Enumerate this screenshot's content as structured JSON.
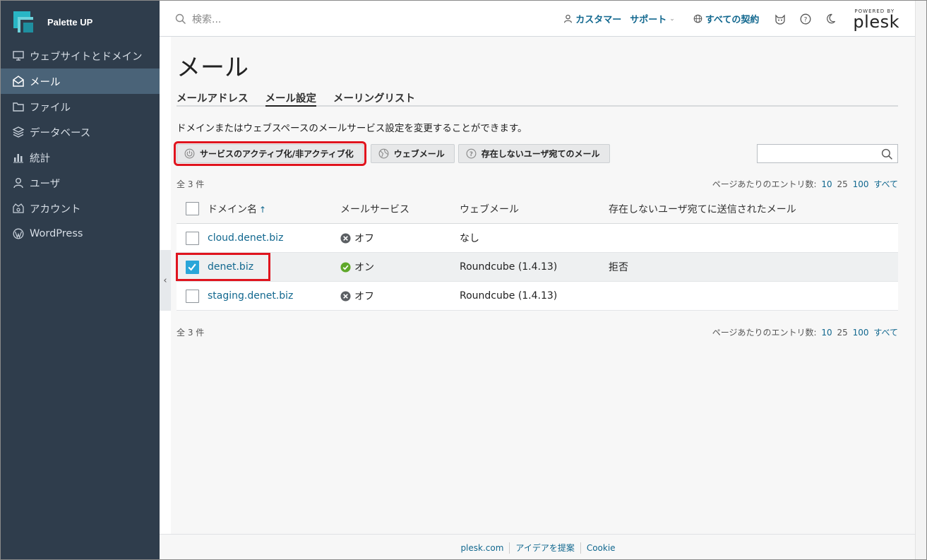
{
  "sidebar": {
    "brand": "Palette UP",
    "items": [
      {
        "label": "ウェブサイトとドメイン",
        "icon": "monitor-icon"
      },
      {
        "label": "メール",
        "icon": "mail-icon"
      },
      {
        "label": "ファイル",
        "icon": "folder-icon"
      },
      {
        "label": "データベース",
        "icon": "database-icon"
      },
      {
        "label": "統計",
        "icon": "stats-icon"
      },
      {
        "label": "ユーザ",
        "icon": "user-icon"
      },
      {
        "label": "アカウント",
        "icon": "account-icon"
      },
      {
        "label": "WordPress",
        "icon": "wordpress-icon"
      }
    ],
    "active_index": 1
  },
  "topbar": {
    "search_placeholder": "検索...",
    "customer": "カスタマー",
    "support": "サポート",
    "subscriptions": "すべての契約",
    "powered_by": "POWERED BY",
    "plesk": "plesk"
  },
  "page": {
    "title": "メール",
    "tabs": [
      "メールアドレス",
      "メール設定",
      "メーリングリスト"
    ],
    "active_tab": 1,
    "description": "ドメインまたはウェブスペースのメールサービス設定を変更することができます。"
  },
  "toolbar": {
    "activate_label": "サービスのアクティブ化/非アクティブ化",
    "webmail_label": "ウェブメール",
    "nonexistent_label": "存在しないユーザ宛てのメール"
  },
  "list": {
    "count_label": "全 3 件",
    "per_page_label": "ページあたりのエントリ数:",
    "per_page_options": [
      "10",
      "25",
      "100",
      "すべて"
    ],
    "columns": [
      "ドメイン名",
      "メールサービス",
      "ウェブメール",
      "存在しないユーザ宛てに送信されたメール"
    ],
    "sort_arrow": "↑",
    "rows": [
      {
        "domain": "cloud.denet.biz",
        "service": "オフ",
        "service_on": false,
        "webmail": "なし",
        "nonexistent": "",
        "checked": false
      },
      {
        "domain": "denet.biz",
        "service": "オン",
        "service_on": true,
        "webmail": "Roundcube (1.4.13)",
        "nonexistent": "拒否",
        "checked": true
      },
      {
        "domain": "staging.denet.biz",
        "service": "オフ",
        "service_on": false,
        "webmail": "Roundcube (1.4.13)",
        "nonexistent": "",
        "checked": false
      }
    ]
  },
  "footer": {
    "links": [
      "plesk.com",
      "アイデアを提案",
      "Cookie"
    ]
  },
  "colors": {
    "sidebar_bg": "#2f3d4c",
    "sidebar_active": "#4a6378",
    "link": "#12688f",
    "checkbox_on": "#2aa6d9",
    "highlight": "#e0141e",
    "status_on": "#5fa82a",
    "status_off": "#555555"
  }
}
